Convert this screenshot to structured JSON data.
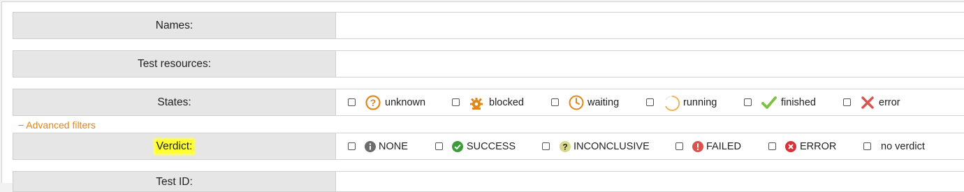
{
  "fields": {
    "names_label": "Names:",
    "resources_label": "Test resources:",
    "states_label": "States:",
    "verdict_label": "Verdict:",
    "testid_label": "Test ID:"
  },
  "advanced_filters_link": "− Advanced filters",
  "states": [
    {
      "label": "unknown",
      "icon": "question-circle-icon"
    },
    {
      "label": "blocked",
      "icon": "blocked-gear-icon"
    },
    {
      "label": "waiting",
      "icon": "clock-icon"
    },
    {
      "label": "running",
      "icon": "spinner-icon"
    },
    {
      "label": "finished",
      "icon": "checkmark-icon"
    },
    {
      "label": "error",
      "icon": "red-x-icon"
    }
  ],
  "verdicts": [
    {
      "label": "NONE",
      "icon": "info-circle-icon"
    },
    {
      "label": "SUCCESS",
      "icon": "check-circle-icon"
    },
    {
      "label": "INCONCLUSIVE",
      "icon": "question-circle-icon"
    },
    {
      "label": "FAILED",
      "icon": "exclamation-circle-icon"
    },
    {
      "label": "ERROR",
      "icon": "x-circle-icon"
    },
    {
      "label": "no verdict",
      "icon": ""
    }
  ],
  "colors": {
    "accent_orange": "#e0861a",
    "success_green": "#3a9d3a",
    "failed_red": "#d9534f",
    "highlight_yellow": "#ffff33"
  }
}
